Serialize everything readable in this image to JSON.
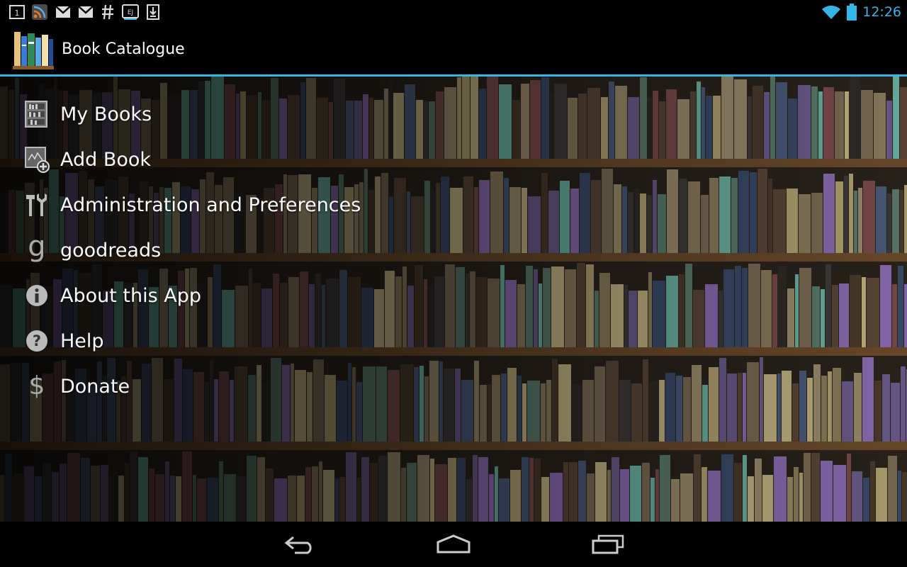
{
  "status_bar": {
    "notification_icons": [
      "calendar-icon",
      "rss-feed-icon",
      "gmail-icon",
      "gmail-icon",
      "hashtag-icon",
      "ebook-icon",
      "download-icon"
    ],
    "calendar_day": "1",
    "time": "12:26",
    "accent_color": "#33b5e5"
  },
  "action_bar": {
    "title": "Book Catalogue",
    "logo_icon": "bookshelf-logo-icon"
  },
  "menu": {
    "items": [
      {
        "label": "My Books",
        "icon": "bookshelf-icon"
      },
      {
        "label": "Add Book",
        "icon": "add-book-icon"
      },
      {
        "label": "Administration and Preferences",
        "icon": "tools-icon"
      },
      {
        "label": "goodreads",
        "icon": "goodreads-g-icon"
      },
      {
        "label": "About this App",
        "icon": "info-icon"
      },
      {
        "label": "Help",
        "icon": "help-icon"
      },
      {
        "label": "Donate",
        "icon": "dollar-icon"
      }
    ]
  },
  "nav_bar": {
    "buttons": [
      "back-icon",
      "home-icon",
      "recent-apps-icon"
    ]
  }
}
